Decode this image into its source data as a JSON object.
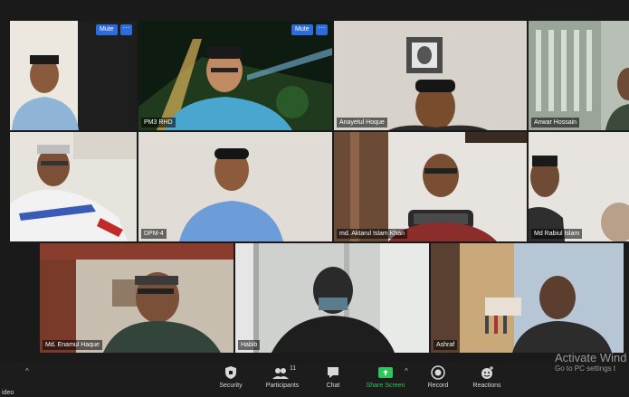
{
  "app": "Zoom Meeting",
  "gallery": {
    "tiles": [
      {
        "name": "",
        "active": true,
        "mute_label": "Mute",
        "more_label": "···"
      },
      {
        "name": "PM3 RHD",
        "mute_label": "Mute",
        "more_label": "···"
      },
      {
        "name": "Anayetul Hoque"
      },
      {
        "name": "Anwar Hossain"
      },
      {
        "name": ""
      },
      {
        "name": "DPM-4"
      },
      {
        "name": "md. Aktarul Islam Khan"
      },
      {
        "name": "Md Rabiul Islam"
      },
      {
        "name": "Md. Enamul Haque"
      },
      {
        "name": "Habib"
      },
      {
        "name": "Ashraf"
      }
    ]
  },
  "toolbar": {
    "video_label": "ideo",
    "items": [
      {
        "label": "Security",
        "icon": "shield-icon"
      },
      {
        "label": "Participants",
        "icon": "participants-icon",
        "count": "11"
      },
      {
        "label": "Chat",
        "icon": "chat-icon"
      },
      {
        "label": "Share Screen",
        "icon": "share-screen-icon"
      },
      {
        "label": "Record",
        "icon": "record-icon"
      },
      {
        "label": "Reactions",
        "icon": "reactions-icon"
      }
    ],
    "colors": {
      "share": "#2ec55a",
      "text": "#d8d8d8"
    }
  },
  "watermark": {
    "title": "Activate Wind",
    "subtitle": "Go to PC settings t"
  }
}
